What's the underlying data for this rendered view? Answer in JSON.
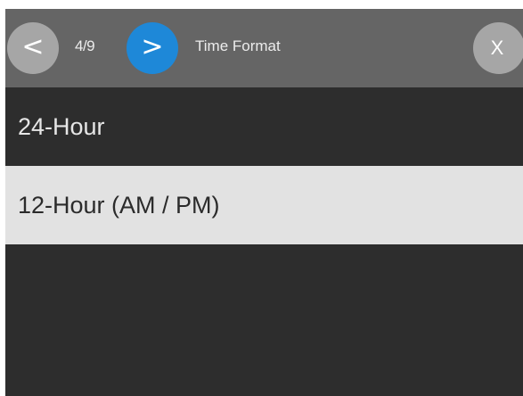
{
  "header": {
    "prev_icon": "<",
    "page_counter": "4/9",
    "next_icon": ">",
    "title": "Time Format",
    "close_icon": "X"
  },
  "options": [
    {
      "label": "24-Hour",
      "selected": false
    },
    {
      "label": "12-Hour (AM / PM)",
      "selected": true
    }
  ],
  "colors": {
    "header_background": "#656565",
    "body_background": "#2d2d2d",
    "next_button": "#1e88d8",
    "nav_button": "#a6a6a6",
    "selected_row": "#e2e2e2"
  }
}
